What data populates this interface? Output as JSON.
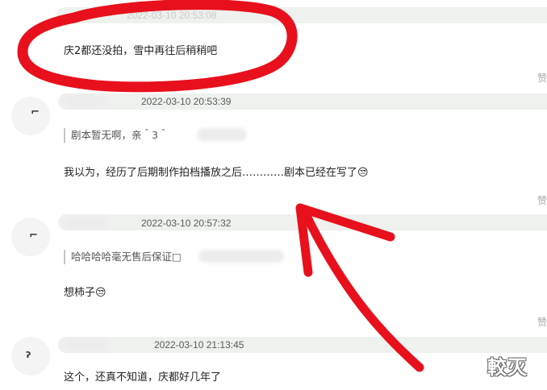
{
  "comments": [
    {
      "timestamp": "2022-03-10 20:53:08",
      "text": "庆2都还没拍，雪中再往后稍稍吧"
    },
    {
      "timestamp": "2022-03-10 20:53:39",
      "quote": "剧本暂无啊，亲＾3＾",
      "text": "我以为，经历了后期制作拍档播放之后…………剧本已经在写了😒"
    },
    {
      "timestamp": "2022-03-10 20:57:32",
      "quote": "哈哈哈哈毫无售后保证□",
      "text": "想柿子😒"
    },
    {
      "timestamp": "2022-03-10 21:13:45",
      "text": "这个，还真不知道，庆都好几年了"
    }
  ],
  "side_label": "赞",
  "watermark": "較灭",
  "annotation": {
    "highlight_color": "#e8101c",
    "arrow_color": "#e8101c"
  }
}
